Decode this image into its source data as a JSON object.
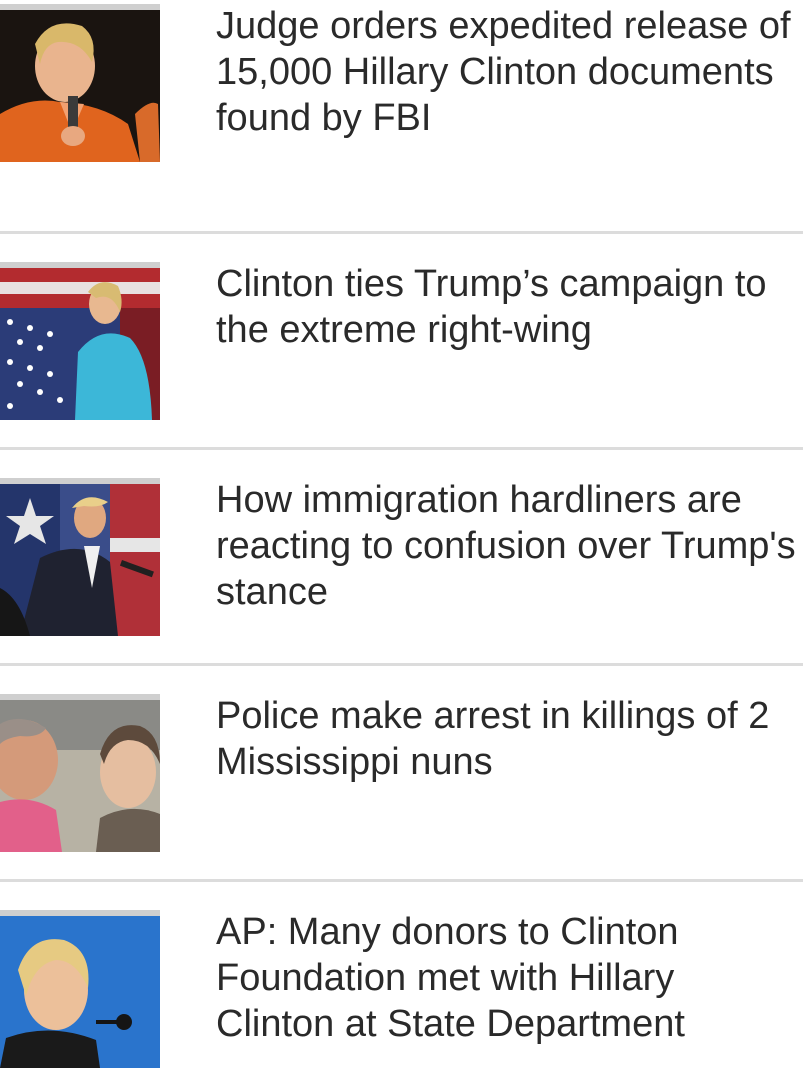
{
  "stories": [
    {
      "headline": "Judge orders expedited release of 15,000 Hillary Clinton documents found by FBI",
      "image": "clinton-speaking-orange-jacket-photo"
    },
    {
      "headline": "Clinton ties Trump’s campaign to the extreme right-wing",
      "image": "clinton-flag-backdrop-photo"
    },
    {
      "headline": "How immigration hardliners are reacting to confusion over Trump's stance",
      "image": "trump-speaking-rally-photo"
    },
    {
      "headline": "Police make arrest in killings of 2 Mississippi nuns",
      "image": "two-nuns-photo"
    },
    {
      "headline": "AP: Many donors to Clinton Foundation met with Hillary Clinton at State Department",
      "image": "clinton-podium-blue-background-photo"
    }
  ],
  "colors": {
    "text": "#2a2a2a",
    "divider": "#dcdcdc",
    "background": "#ffffff"
  }
}
